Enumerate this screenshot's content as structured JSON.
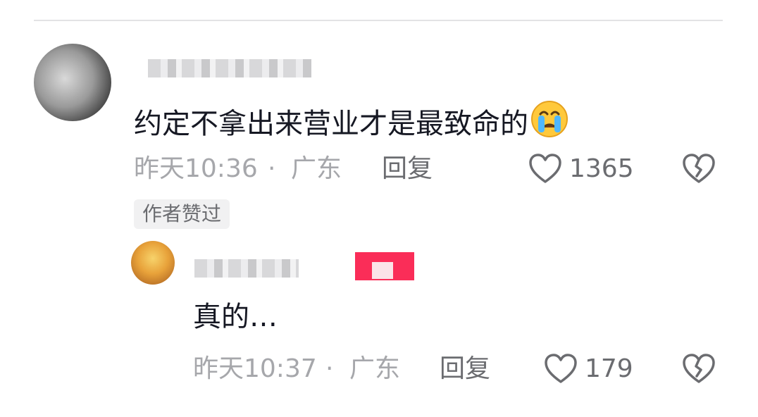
{
  "comments": [
    {
      "text": "约定不拿出来营业才是最致命的",
      "emoji_icon": "crying-face-icon",
      "time": "昨天10:36",
      "separator": "·",
      "location": "广东",
      "reply_label": "回复",
      "like_count": "1365",
      "author_badge": "作者赞过"
    },
    {
      "text": "真的…",
      "time": "昨天10:37",
      "separator": "·",
      "location": "广东",
      "reply_label": "回复",
      "like_count": "179"
    }
  ],
  "colors": {
    "text_primary": "#161823",
    "text_meta": "#a6a7ab",
    "text_action": "#6b6c70",
    "badge_bg": "#f1f1f2",
    "censor_red": "#fa2d58"
  },
  "icons": {
    "like": "heart-outline-icon",
    "dislike": "broken-heart-icon"
  }
}
